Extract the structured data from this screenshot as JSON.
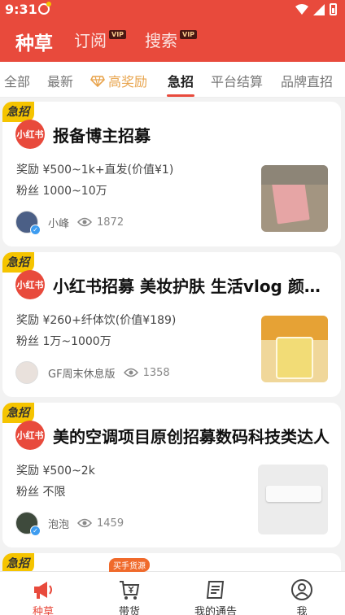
{
  "status_bar": {
    "time": "9:31"
  },
  "top_nav": {
    "tabs": [
      {
        "label": "种草",
        "active": true
      },
      {
        "label": "订阅",
        "badge": "VIP"
      },
      {
        "label": "搜索",
        "badge": "VIP"
      }
    ]
  },
  "categories": [
    {
      "label": "全部"
    },
    {
      "label": "最新"
    },
    {
      "label": "高奖励",
      "icon": "gem-icon"
    },
    {
      "label": "急招",
      "active": true
    },
    {
      "label": "平台结算"
    },
    {
      "label": "品牌直招"
    }
  ],
  "cards": [
    {
      "tag": "急招",
      "brand": "小红书",
      "title": "报备博主招募",
      "reward": "奖励 ¥500~1k+直发(价值¥1)",
      "fans": "粉丝 1000~10万",
      "user": "小峰",
      "views": "1872",
      "verified": true
    },
    {
      "tag": "急招",
      "brand": "小红书",
      "title": "小红书招募 美妆护肤 生活vlog 颜值达人",
      "reward": "奖励 ¥260+纤体饮(价值¥189)",
      "fans": "粉丝 1万~1000万",
      "user": "GF周末休息版",
      "views": "1358",
      "verified": false
    },
    {
      "tag": "急招",
      "brand": "小红书",
      "title": "美的空调项目原创招募数码科技类达人",
      "reward": "奖励 ¥500~2k",
      "fans": "粉丝 不限",
      "user": "泡泡",
      "views": "1459",
      "verified": true
    },
    {
      "tag": "急招"
    }
  ],
  "bottom_nav": {
    "items": [
      {
        "label": "种草",
        "icon": "megaphone-icon",
        "active": true
      },
      {
        "label": "带货",
        "icon": "cart-icon",
        "badge": "买手货源"
      },
      {
        "label": "我的通告",
        "icon": "notice-icon"
      },
      {
        "label": "我",
        "icon": "profile-icon"
      }
    ]
  },
  "colors": {
    "brand": "#e84a3c",
    "urgent": "#f5c400",
    "prize": "#e8a44d"
  }
}
